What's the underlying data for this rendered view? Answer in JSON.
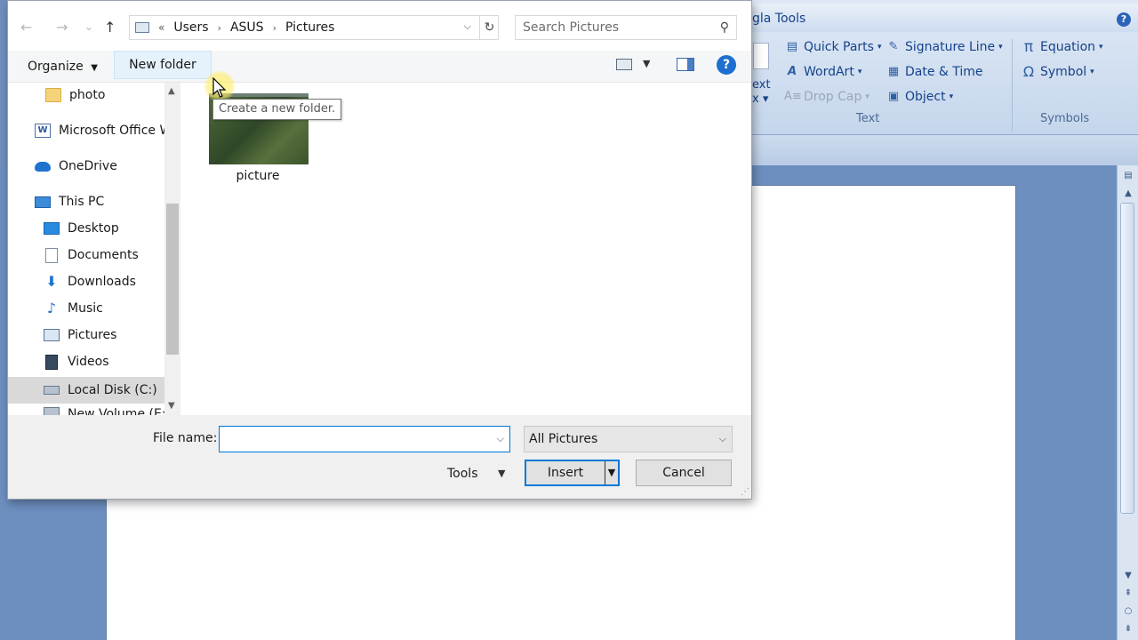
{
  "word": {
    "ribbon_title": "gla Tools",
    "ribbon_help": "?",
    "partial_left_top": "ext",
    "partial_left_bottom": "x",
    "text_group": {
      "label": "Text",
      "items": [
        {
          "label": "Quick Parts",
          "icon": "quick-parts-icon"
        },
        {
          "label": "WordArt",
          "icon": "wordart-icon"
        },
        {
          "label": "Drop Cap",
          "icon": "drop-cap-icon",
          "disabled": true
        },
        {
          "label": "Signature Line",
          "icon": "signature-line-icon"
        },
        {
          "label": "Date & Time",
          "icon": "date-time-icon"
        },
        {
          "label": "Object",
          "icon": "object-icon"
        }
      ]
    },
    "symbols_group": {
      "label": "Symbols",
      "items": [
        {
          "label": "Equation",
          "glyph": "π"
        },
        {
          "label": "Symbol",
          "glyph": "Ω"
        }
      ]
    }
  },
  "dialog": {
    "nav": {
      "back": "←",
      "forward": "→",
      "recent": "⌄",
      "up": "↑"
    },
    "address": {
      "overflow": "«",
      "crumbs": [
        "Users",
        "ASUS",
        "Pictures"
      ],
      "refresh": "↻"
    },
    "search": {
      "placeholder": "Search Pictures"
    },
    "toolbar": {
      "organize_label": "Organize",
      "new_folder_label": "New folder",
      "help_label": "?"
    },
    "nav_pane": {
      "items": [
        {
          "label": "photo",
          "icon": "folder-icon"
        },
        {
          "label": "Microsoft Office W",
          "icon": "word-icon"
        },
        {
          "label": "OneDrive",
          "icon": "onedrive-icon"
        },
        {
          "label": "This PC",
          "icon": "this-pc-icon"
        },
        {
          "label": "Desktop",
          "icon": "desktop-icon"
        },
        {
          "label": "Documents",
          "icon": "documents-icon"
        },
        {
          "label": "Downloads",
          "icon": "downloads-icon"
        },
        {
          "label": "Music",
          "icon": "music-icon"
        },
        {
          "label": "Pictures",
          "icon": "pictures-icon"
        },
        {
          "label": "Videos",
          "icon": "videos-icon"
        },
        {
          "label": "Local Disk (C:)",
          "icon": "local-disk-icon",
          "selected": true
        },
        {
          "label": "New Volume (E:)",
          "icon": "volume-icon"
        }
      ]
    },
    "files": [
      {
        "name": "picture"
      }
    ],
    "tooltip": "Create a new folder.",
    "bottom": {
      "file_name_label": "File name:",
      "file_name_value": "",
      "filter_value": "All Pictures",
      "tools_label": "Tools",
      "insert_label": "Insert",
      "cancel_label": "Cancel"
    }
  }
}
